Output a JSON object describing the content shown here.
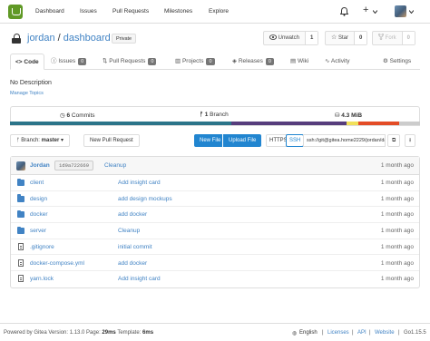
{
  "nav": {
    "links": [
      "Dashboard",
      "Issues",
      "Pull Requests",
      "Milestones",
      "Explore"
    ],
    "bell_icon": "bell-icon",
    "plus_label": "+",
    "plus_icon": "plus-icon"
  },
  "repo": {
    "owner": "jordan",
    "separator": " / ",
    "name": "dashboard",
    "private_label": "Private",
    "watch_label": "Unwatch",
    "watch_count": "1",
    "star_label": "Star",
    "star_count": "0",
    "fork_label": "Fork",
    "fork_count": "0"
  },
  "tabs": [
    {
      "label": "Code",
      "icon": "code-icon"
    },
    {
      "label": "Issues",
      "badge": "0",
      "icon": "issue-icon"
    },
    {
      "label": "Pull Requests",
      "badge": "0",
      "icon": "pull-request-icon"
    },
    {
      "label": "Projects",
      "badge": "0",
      "icon": "projects-icon"
    },
    {
      "label": "Releases",
      "badge": "0",
      "icon": "tag-icon"
    },
    {
      "label": "Wiki",
      "icon": "book-icon"
    },
    {
      "label": "Activity",
      "icon": "pulse-icon"
    },
    {
      "label": "Settings",
      "icon": "gear-icon"
    }
  ],
  "description": "No Description",
  "manage_topics": "Manage Topics",
  "stats": {
    "commits_count": "6",
    "commits_label": "Commits",
    "branch_count": "1",
    "branch_label": "Branch",
    "size": "4.3 MiB"
  },
  "language_bar": [
    {
      "color": "#2b7489",
      "fraction": 0.54
    },
    {
      "color": "#563d7c",
      "fraction": 0.28
    },
    {
      "color": "#f1e05a",
      "fraction": 0.03
    },
    {
      "color": "#e34c26",
      "fraction": 0.1
    },
    {
      "color": "#cccccc",
      "fraction": 0.05
    }
  ],
  "toolbar": {
    "branch_label": "Branch:",
    "branch_value": "master",
    "new_pr": "New Pull Request",
    "new_file": "New File",
    "upload_file": "Upload File",
    "https": "HTTPS",
    "ssh": "SSH",
    "clone_url": "ssh://git@gitea.home2229/jordan/dashboard.git"
  },
  "last_commit": {
    "author": "Jordan",
    "sha": "1d9a722669",
    "message": "Cleanup",
    "time": "1 month ago"
  },
  "files": [
    {
      "name": "client",
      "type": "dir",
      "message": "Add insight card",
      "time": "1 month ago"
    },
    {
      "name": "design",
      "type": "dir",
      "message": "add design mockups",
      "time": "1 month ago"
    },
    {
      "name": "docker",
      "type": "dir",
      "message": "add docker",
      "time": "1 month ago"
    },
    {
      "name": "server",
      "type": "dir",
      "message": "Cleanup",
      "time": "1 month ago"
    },
    {
      "name": ".gitignore",
      "type": "file",
      "message": "initial commit",
      "time": "1 month ago"
    },
    {
      "name": "docker-compose.yml",
      "type": "file",
      "message": "add docker",
      "time": "1 month ago"
    },
    {
      "name": "yarn.lock",
      "type": "file",
      "message": "Add insight card",
      "time": "1 month ago"
    }
  ],
  "footer": {
    "powered": "Powered by Gitea Version: 1.13.0 Page:",
    "page_time": "29ms",
    "template_label": "Template:",
    "template_time": "6ms",
    "language": "English",
    "licenses": "Licenses",
    "api": "API",
    "website": "Website",
    "go_version": "Go1.15.5"
  }
}
